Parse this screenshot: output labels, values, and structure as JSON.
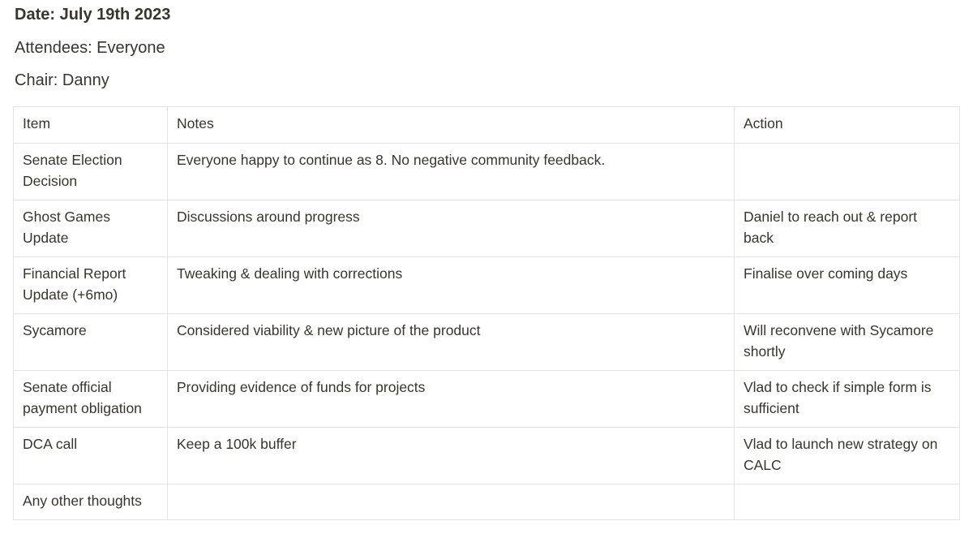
{
  "meta": {
    "date": "Date: July 19th 2023",
    "attendees": "Attendees: Everyone",
    "chair": "Chair: Danny"
  },
  "table": {
    "headers": {
      "item": "Item",
      "notes": "Notes",
      "action": "Action"
    },
    "rows": [
      {
        "item": "Senate Election Decision",
        "notes": "Everyone happy to continue as 8. No negative community feedback.",
        "action": ""
      },
      {
        "item": "Ghost Games Update",
        "notes": "Discussions around progress",
        "action": "Daniel to reach out & report back"
      },
      {
        "item": "Financial Report Update (+6mo)",
        "notes": "Tweaking & dealing with corrections",
        "action": "Finalise over coming days"
      },
      {
        "item": "Sycamore",
        "notes": "Considered viability & new picture of the product",
        "action": "Will reconvene with Sycamore shortly"
      },
      {
        "item": "Senate official payment obligation",
        "notes": "Providing evidence of funds for projects",
        "action": "Vlad to check if simple form is sufficient"
      },
      {
        "item": "DCA call",
        "notes": "Keep a 100k buffer",
        "action": "Vlad to launch new strategy on CALC"
      },
      {
        "item": "Any other thoughts",
        "notes": "",
        "action": ""
      }
    ]
  }
}
